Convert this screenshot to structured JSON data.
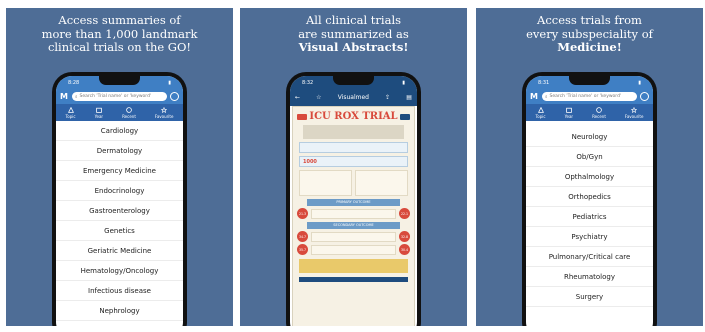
{
  "panels": [
    {
      "caption_lines": [
        "Access summaries of",
        "more than 1,000 landmark",
        "clinical trials on the GO!"
      ]
    },
    {
      "caption_lines": [
        "All clinical trials",
        "are summarized as"
      ],
      "caption_bold": "Visual Abstracts!"
    },
    {
      "caption_lines": [
        "Access trials from",
        "every subspeciality of"
      ],
      "caption_bold": "Medicine!"
    }
  ],
  "status_times": [
    "8:28",
    "8:32",
    "8:31"
  ],
  "app": {
    "logo": "M",
    "search_placeholder": "Search 'Trial name' or 'keyword'",
    "tabs": [
      "Topic",
      "Year",
      "Recent",
      "Favourite"
    ]
  },
  "screen1_list": [
    "Cardiology",
    "Dermatology",
    "Emergency Medicine",
    "Endocrinology",
    "Gastroenterology",
    "Genetics",
    "Geriatric Medicine",
    "Hematology/Oncology",
    "Infectious disease",
    "Nephrology"
  ],
  "screen2": {
    "header_title": "Visualmed",
    "trial_title": "ICU ROX TRIAL",
    "primary_outcome": "PRIMARY OUTCOME",
    "secondary_outcome": "SECONDARY OUTCOME",
    "stat_value": "1000",
    "outcome_values": [
      [
        "21.3",
        "22.1"
      ],
      [
        "34.7",
        "32.8"
      ],
      [
        "35.7",
        "30.4"
      ]
    ]
  },
  "screen3_list": [
    "Neurology",
    "Ob/Gyn",
    "Opthalmology",
    "Orthopedics",
    "Pediatrics",
    "Psychiatry",
    "Pulmonary/Critical care",
    "Rheumatology",
    "Surgery"
  ],
  "colors": {
    "panel_bg": "#4e6d96",
    "app_blue": "#3f7fc4",
    "tab_blue": "#2f63a8",
    "accent_red": "#d84a3c"
  }
}
